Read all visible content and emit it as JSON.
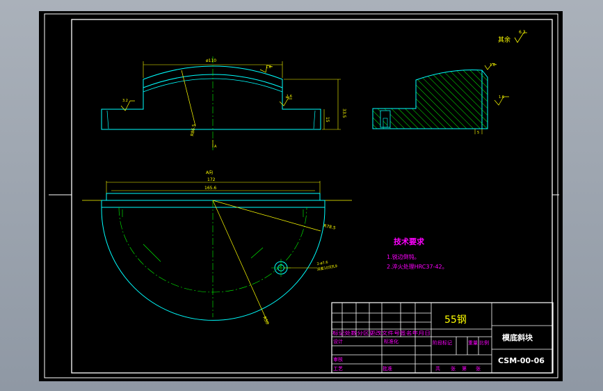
{
  "colors": {
    "background": "#000000",
    "frame": "#ffffff",
    "geometry": "#00ffff",
    "annotation": "#ffff00",
    "centerline": "#00ff00",
    "title_text": "#ff00ff",
    "hatch": "#00ff00"
  },
  "drawing": {
    "roughness_rest_label": "其余",
    "roughness_rest_value": "6.3",
    "front_view": {
      "dim_arc": "ø110",
      "dim_radius": "R86.5",
      "dim_height": "33.5",
      "dim_step": "15",
      "dim_small": "2",
      "roughness_left": "3.2",
      "roughness_top": "1.6",
      "roughness_right": "1.6",
      "section_mark": "A"
    },
    "side_view": {
      "roughness_corner": "1.6",
      "roughness_right": "1.6",
      "dim_bottom": "5"
    },
    "plan_view": {
      "view_label": "A向",
      "dim_overall": "172",
      "dim_inner": "165.6",
      "dim_radius_outer": "R78.5",
      "dim_radius_inner": "R50",
      "hole_note_1": "2-ø7.6",
      "hole_note_2": "深度10沉孔9"
    },
    "tech_requirements": {
      "heading": "技术要求",
      "item1": "1.锐边倒钝。",
      "item2": "2.淬火处理HRC37-42。"
    },
    "title_block": {
      "material": "55钢",
      "part_name": "模底斜块",
      "drawing_no": "CSM-00-06",
      "row_header": "标记处数分区更改文件号签名年月日",
      "designer": "设计",
      "standardization": "标准化",
      "stage_mark": "阶段标记",
      "weight": "重量",
      "scale": "比例",
      "review": "审核",
      "process": "工艺",
      "approve": "批准",
      "sheets_total": "共",
      "sheets_label": "张",
      "sheet_no": "第",
      "sheet_label": "张"
    }
  }
}
